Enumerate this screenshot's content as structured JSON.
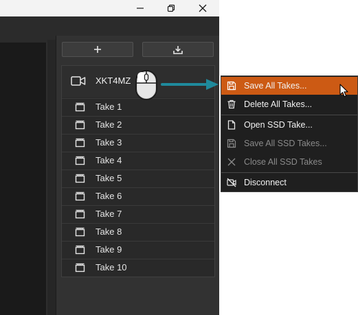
{
  "window_controls": [
    {
      "name": "minimize",
      "icon": "minimize-icon"
    },
    {
      "name": "maximize",
      "icon": "restore-icon"
    },
    {
      "name": "close",
      "icon": "close-icon"
    }
  ],
  "toolbar": {
    "add_icon": "plus-icon",
    "import_icon": "download-icon"
  },
  "device": {
    "label": "XKT4MZ",
    "icon": "camera-icon"
  },
  "takes": [
    {
      "label": "Take 1"
    },
    {
      "label": "Take 2"
    },
    {
      "label": "Take 3"
    },
    {
      "label": "Take 4"
    },
    {
      "label": "Take 5"
    },
    {
      "label": "Take 6"
    },
    {
      "label": "Take 7"
    },
    {
      "label": "Take 8"
    },
    {
      "label": "Take 9"
    },
    {
      "label": "Take 10"
    }
  ],
  "context_menu": {
    "items": [
      {
        "label": "Save All Takes...",
        "icon": "save-icon",
        "state": "highlighted"
      },
      {
        "label": "Delete All Takes...",
        "icon": "trash-icon",
        "state": "enabled"
      },
      {
        "label": "Open SSD Take...",
        "icon": "file-icon",
        "state": "enabled"
      },
      {
        "label": "Save All SSD Takes...",
        "icon": "save-icon",
        "state": "disabled"
      },
      {
        "label": "Close All SSD Takes",
        "icon": "close-icon",
        "state": "disabled"
      },
      {
        "label": "Disconnect",
        "icon": "camera-off-icon",
        "state": "enabled"
      }
    ]
  },
  "colors": {
    "menu_highlight": "#cc5a14",
    "arrow": "#1f8a9c"
  }
}
